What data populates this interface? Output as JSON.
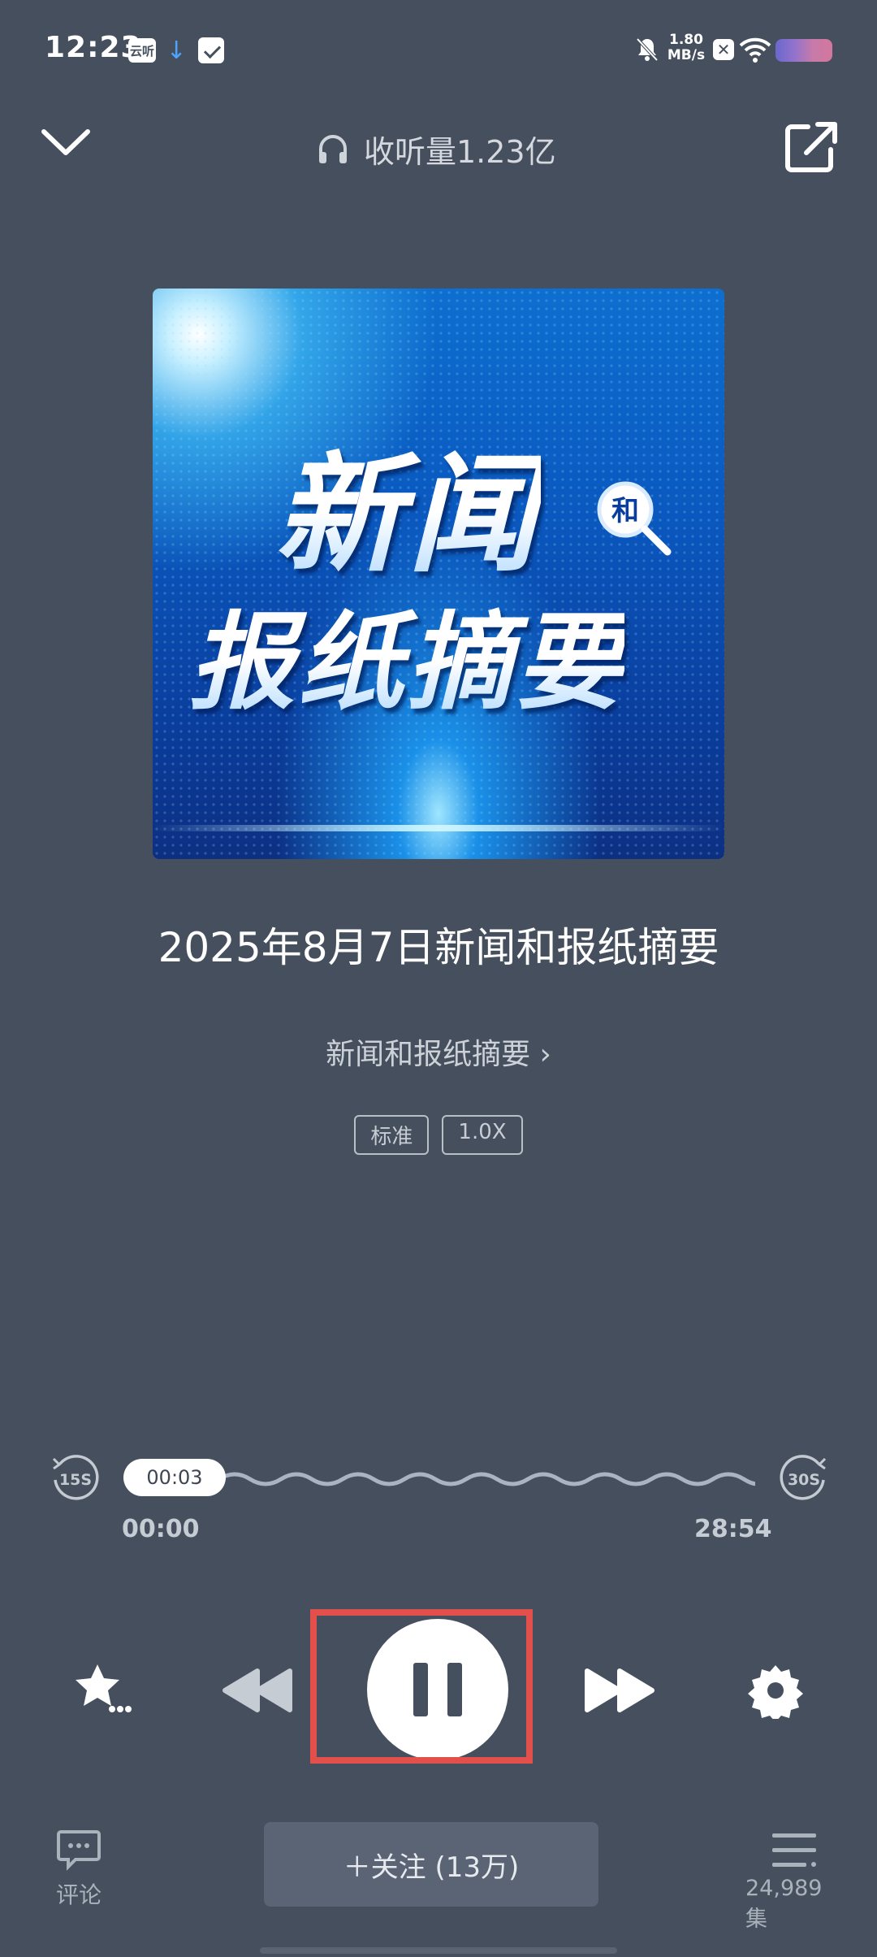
{
  "status_bar": {
    "time": "12:23",
    "app_icon_text": "云听",
    "net_speed_value": "1.80",
    "net_speed_unit": "MB/s"
  },
  "header": {
    "listen_count": "收听量1.23亿"
  },
  "cover": {
    "line1": "新闻",
    "badge": "和",
    "line2": "报纸摘要"
  },
  "episode": {
    "title": "2025年8月7日新闻和报纸摘要",
    "album_link": "新闻和报纸摘要 ›"
  },
  "tags": {
    "quality": "标准",
    "speed": "1.0X"
  },
  "player": {
    "skip_back_label": "15S",
    "skip_forward_label": "30S",
    "current_time": "00:03",
    "start_time": "00:00",
    "end_time": "28:54",
    "progress_fraction": 0.0017,
    "state": "playing"
  },
  "bottom": {
    "comment_label": "评论",
    "follow_label": "＋关注 (13万)",
    "episodes_label": "24,989集"
  },
  "colors": {
    "background": "#454f5d",
    "highlight_border": "#e34f4a",
    "follow_button": "#5a6474"
  }
}
